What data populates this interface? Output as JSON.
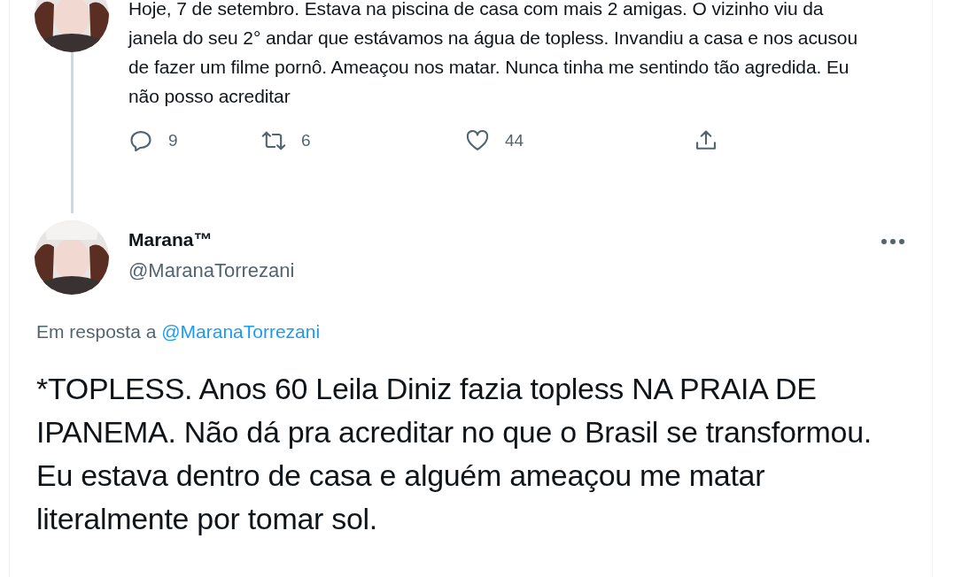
{
  "parent_tweet": {
    "text": "Hoje, 7 de setembro. Estava na piscina de casa com mais 2 amigas. O vizinho viu da janela do seu 2° andar que estávamos na água de topless. Invandiu a casa e nos acusou de fazer um filme pornô. Ameaçou nos matar. Nunca tinha me sentindo tão agredida. Eu não posso acreditar",
    "actions": [
      {
        "kind": "reply",
        "count": "9"
      },
      {
        "kind": "retweet",
        "count": "6"
      },
      {
        "kind": "like",
        "count": "44"
      },
      {
        "kind": "share"
      }
    ]
  },
  "tweet": {
    "name": "Marana™",
    "handle": "@MaranaTorrezani",
    "reply_prefix": "Em resposta a",
    "reply_to": "@MaranaTorrezani",
    "text": "*TOPLESS.  Anos 60 Leila Diniz fazia topless NA PRAIA DE IPANEMA. Não dá pra acreditar no que o Brasil se transformou. Eu estava dentro de casa e alguém ameaçou me matar literalmente por tomar sol."
  }
}
